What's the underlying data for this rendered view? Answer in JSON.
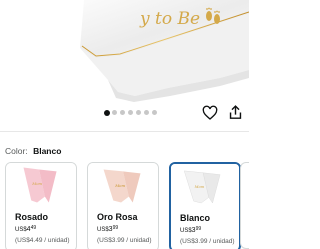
{
  "product": {
    "sash_text": "y to Be",
    "carousel_total": 7,
    "carousel_active": 1
  },
  "color_selector": {
    "label": "Color:",
    "selected_value": "Blanco",
    "options": [
      {
        "name": "Rosado",
        "price_currency": "US$",
        "price_whole": "4",
        "price_cents": "49",
        "unit_price": "(US$4.49 / unidad)",
        "sash_color": "#f6c9d2",
        "selected": false
      },
      {
        "name": "Oro Rosa",
        "price_currency": "US$",
        "price_whole": "3",
        "price_cents": "99",
        "unit_price": "(US$3.99 / unidad)",
        "sash_color": "#f4d7cc",
        "selected": false
      },
      {
        "name": "Blanco",
        "price_currency": "US$",
        "price_whole": "3",
        "price_cents": "99",
        "unit_price": "(US$3.99 / unidad)",
        "sash_color": "#f2f2f2",
        "selected": true
      }
    ]
  },
  "colors": {
    "accent": "#2162a1",
    "gold": "#d4a94a",
    "text": "#0f1111",
    "muted": "#565959"
  },
  "icons": {
    "wishlist": "heart-icon",
    "share": "share-icon"
  }
}
